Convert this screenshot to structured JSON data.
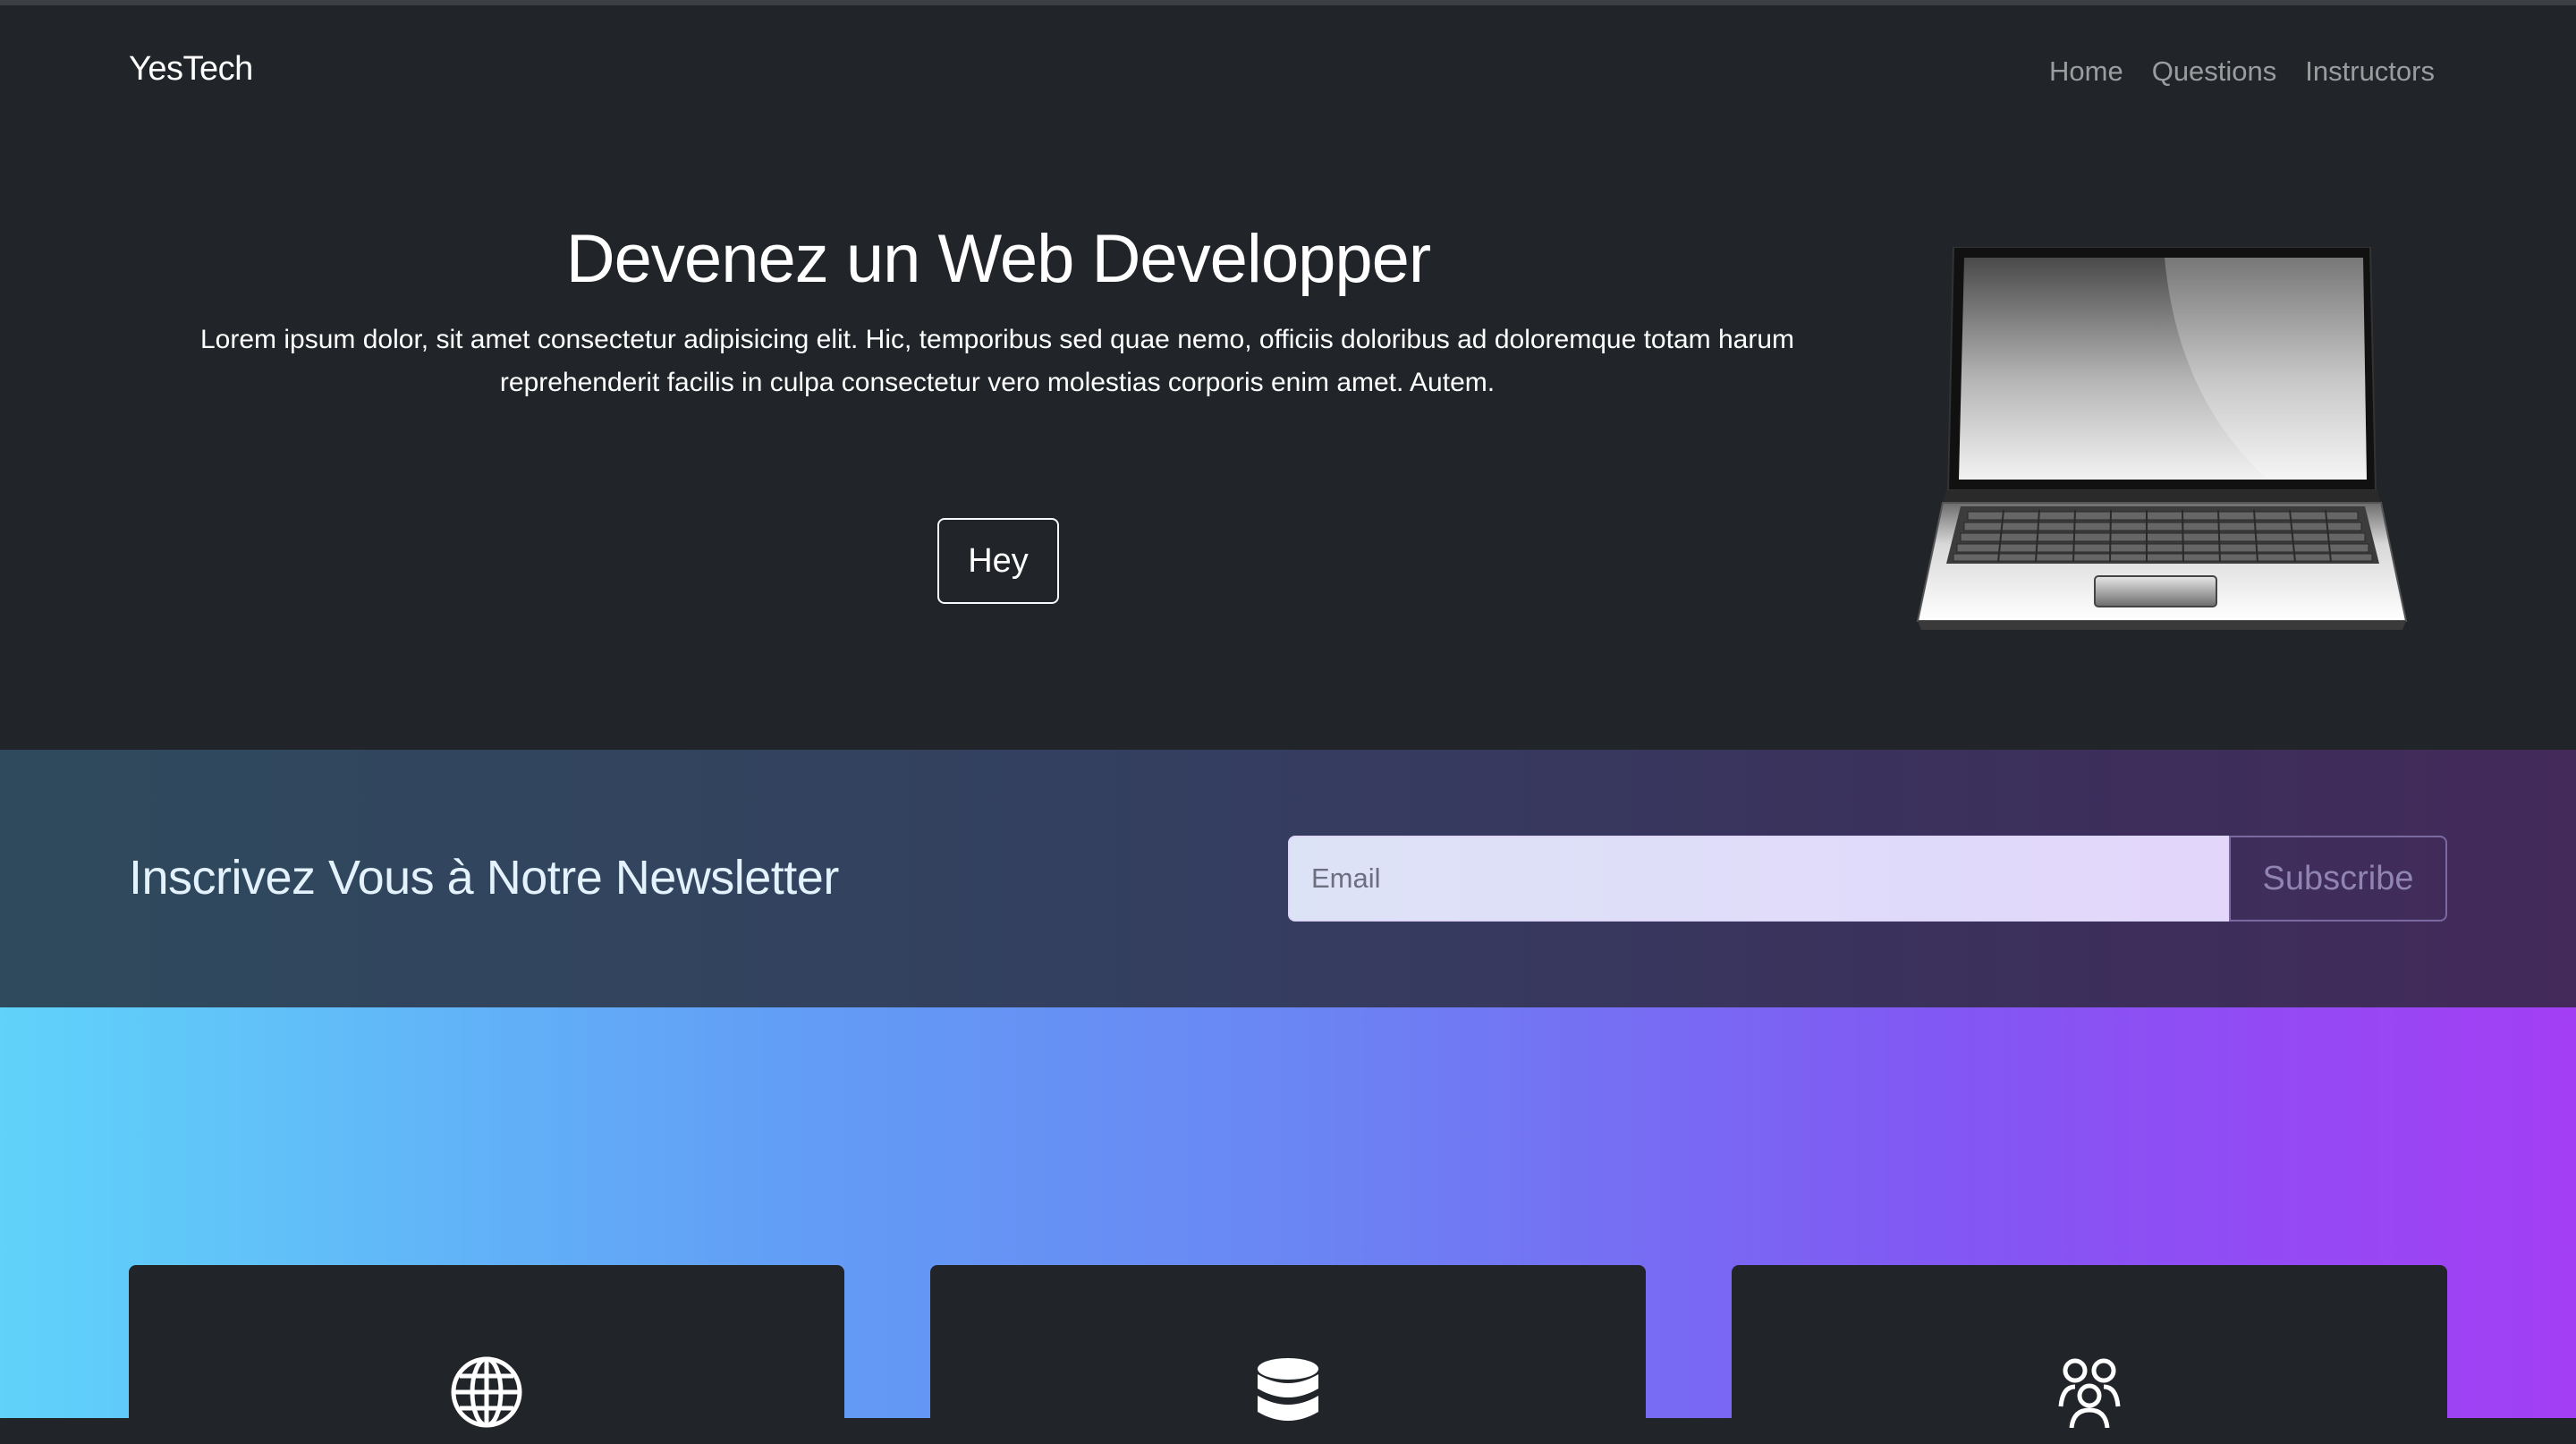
{
  "navbar": {
    "brand": "YesTech",
    "links": [
      "Home",
      "Questions",
      "Instructors"
    ]
  },
  "hero": {
    "title": "Devenez un Web Developper",
    "text": "Lorem ipsum dolor, sit amet consectetur adipisicing elit. Hic, temporibus sed quae nemo, officiis doloribus ad doloremque totam harum reprehenderit facilis in culpa consectetur vero molestias corporis enim amet. Autem.",
    "button_label": "Hey",
    "image": "laptop-illustration"
  },
  "newsletter": {
    "title": "Inscrivez Vous à Notre Newsletter",
    "email_placeholder": "Email",
    "email_value": "",
    "subscribe_label": "Subscribe"
  },
  "features": {
    "cards": [
      {
        "icon": "globe-icon"
      },
      {
        "icon": "database-icon"
      },
      {
        "icon": "people-icon"
      }
    ]
  },
  "colors": {
    "dark_bg": "#212529",
    "gradient_start": "#60d3fa",
    "gradient_end": "#a33ef4"
  }
}
